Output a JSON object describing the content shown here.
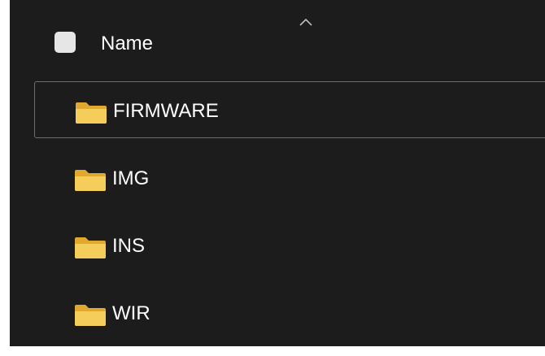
{
  "header": {
    "name_label": "Name"
  },
  "files": [
    {
      "name": "FIRMWARE",
      "selected": true
    },
    {
      "name": "IMG",
      "selected": false
    },
    {
      "name": "INS",
      "selected": false
    },
    {
      "name": "WIR",
      "selected": false
    }
  ],
  "icons": {
    "sort": "chevron-up-icon",
    "folder": "folder-icon"
  },
  "colors": {
    "background": "#1c1c1c",
    "folder_body": "#f2c94c",
    "folder_tab": "#e0a82e",
    "text": "#ffffff",
    "selection_border": "#6e6e6e"
  }
}
